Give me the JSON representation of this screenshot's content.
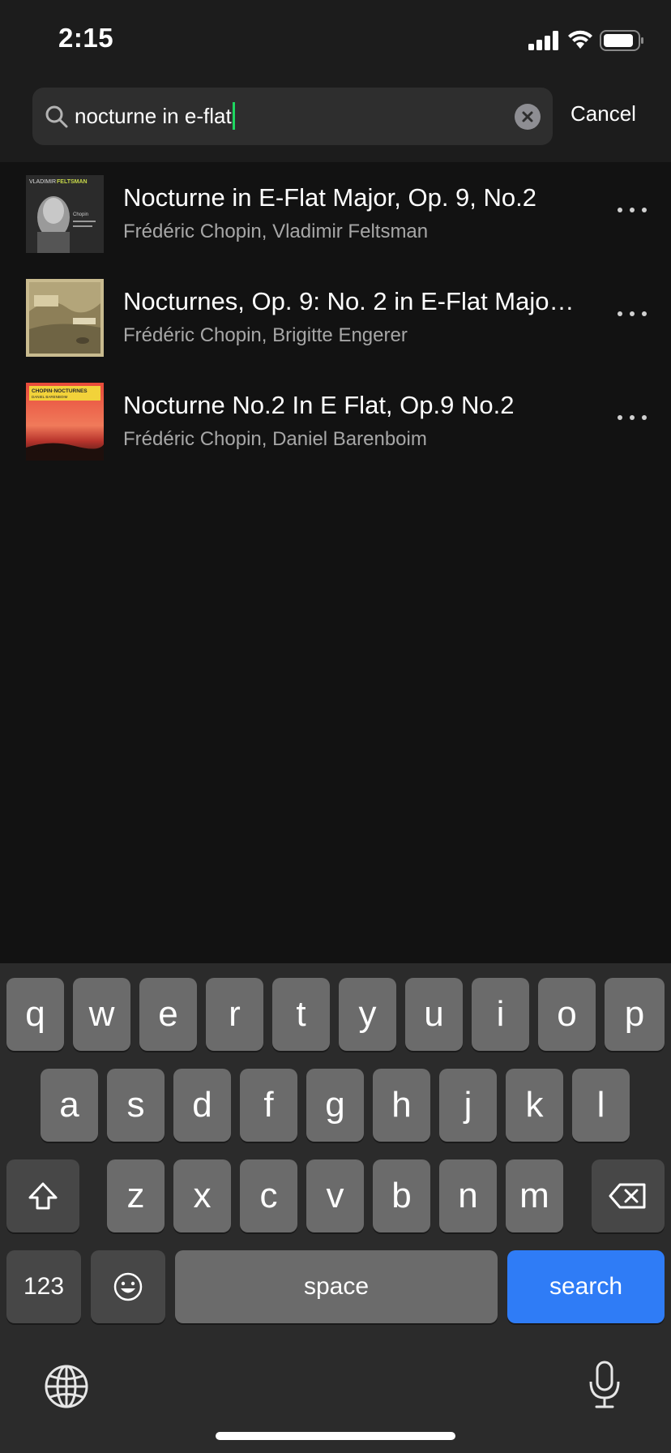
{
  "status_bar": {
    "time": "2:15",
    "icons": [
      "cellular-signal-icon",
      "wifi-icon",
      "battery-icon"
    ]
  },
  "search": {
    "query": "nocturne in e-flat",
    "cancel_label": "Cancel",
    "icons": [
      "search-icon",
      "clear-icon"
    ],
    "caret_color": "#1ed760"
  },
  "results": [
    {
      "title": "Nocturne in E-Flat Major, Op. 9, No.2",
      "artist": "Frédéric Chopin, Vladimir Feltsman",
      "cover_text": [
        "VLADIMIR",
        "FELTSMAN",
        "Chopin"
      ]
    },
    {
      "title": "Nocturnes, Op. 9: No. 2 in E-Flat Majo…",
      "artist": "Frédéric Chopin, Brigitte Engerer"
    },
    {
      "title": "Nocturne No.2 In E Flat, Op.9 No.2",
      "artist": "Frédéric Chopin, Daniel Barenboim",
      "cover_text": [
        "CHOPIN·NOCTURNES",
        "DANIEL BARENBOIM"
      ]
    }
  ],
  "keyboard": {
    "row1": [
      "q",
      "w",
      "e",
      "r",
      "t",
      "y",
      "u",
      "i",
      "o",
      "p"
    ],
    "row2": [
      "a",
      "s",
      "d",
      "f",
      "g",
      "h",
      "j",
      "k",
      "l"
    ],
    "row3": [
      "z",
      "x",
      "c",
      "v",
      "b",
      "n",
      "m"
    ],
    "numbers_label": "123",
    "space_label": "space",
    "search_label": "search",
    "accent": "#2f7cf6"
  }
}
